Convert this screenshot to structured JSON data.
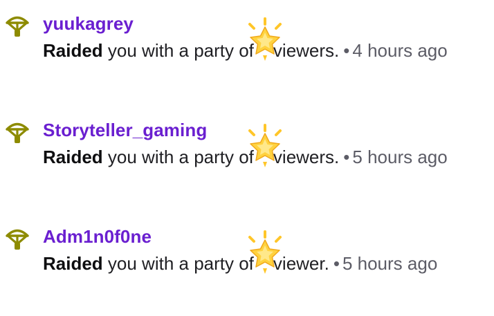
{
  "colors": {
    "username": "#6a1fd0",
    "icon": "#8d8b00",
    "meta": "#5c5c66",
    "text": "#1f1f23",
    "star": "#ffc629"
  },
  "notifications": [
    {
      "icon": "raid-parachute-icon",
      "username": "yuukagrey",
      "action": "Raided",
      "message_before": " you with a party of",
      "viewer_count_icon": "star-emoji-icon",
      "message_after": "viewers.",
      "separator": "•",
      "time": "4 hours ago"
    },
    {
      "icon": "raid-parachute-icon",
      "username": "Storyteller_gaming",
      "action": "Raided",
      "message_before": " you with a party of",
      "viewer_count_icon": "star-emoji-icon",
      "message_after": "viewers.",
      "separator": "•",
      "time": "5 hours ago"
    },
    {
      "icon": "raid-parachute-icon",
      "username": "Adm1n0f0ne",
      "action": "Raided",
      "message_before": " you with a party of",
      "viewer_count_icon": "star-emoji-icon",
      "message_after": "viewer.",
      "separator": "•",
      "time": "5 hours ago"
    }
  ]
}
